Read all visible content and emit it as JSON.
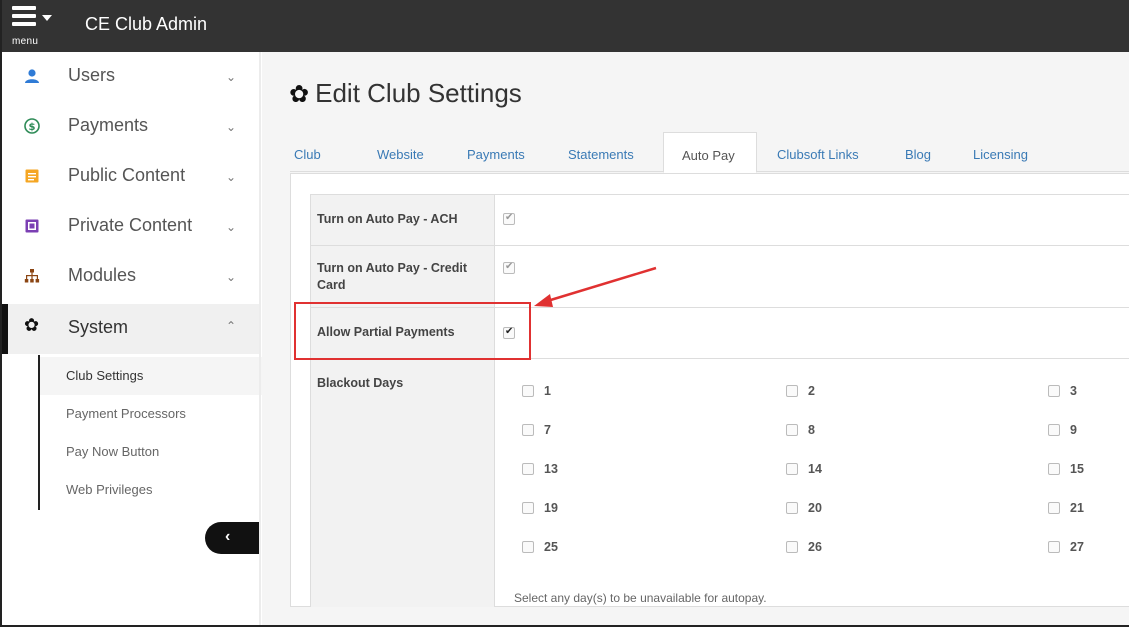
{
  "app": {
    "title": "CE Club Admin",
    "menu_label": "menu"
  },
  "sidebar": {
    "items": [
      {
        "label": "Users",
        "icon": "user-icon"
      },
      {
        "label": "Payments",
        "icon": "dollar-circle-icon"
      },
      {
        "label": "Public Content",
        "icon": "document-icon"
      },
      {
        "label": "Private Content",
        "icon": "private-document-icon"
      },
      {
        "label": "Modules",
        "icon": "sitemap-icon"
      },
      {
        "label": "System",
        "icon": "gear-icon"
      }
    ],
    "sub_items": [
      {
        "label": "Club Settings"
      },
      {
        "label": "Payment Processors"
      },
      {
        "label": "Pay Now Button"
      },
      {
        "label": "Web Privileges"
      }
    ]
  },
  "page": {
    "title": "Edit Club Settings"
  },
  "tabs": [
    {
      "label": "Club"
    },
    {
      "label": "Website"
    },
    {
      "label": "Payments"
    },
    {
      "label": "Statements"
    },
    {
      "label": "Auto Pay"
    },
    {
      "label": "Clubsoft Links"
    },
    {
      "label": "Blog"
    },
    {
      "label": "Licensing"
    }
  ],
  "settings": {
    "ach_label": "Turn on Auto Pay - ACH",
    "ach_checked": true,
    "credit_label": "Turn on Auto Pay - Credit Card",
    "credit_checked": true,
    "partial_label": "Allow Partial Payments",
    "partial_checked": true,
    "blackout_label": "Blackout Days",
    "blackout_days": [
      "1",
      "2",
      "3",
      "7",
      "8",
      "9",
      "13",
      "14",
      "15",
      "19",
      "20",
      "21",
      "25",
      "26",
      "27"
    ],
    "helper": "Select any day(s) to be unavailable for autopay."
  },
  "colors": {
    "topbar": "#333333",
    "link": "#3a7ab5",
    "annotation": "#e03131"
  }
}
